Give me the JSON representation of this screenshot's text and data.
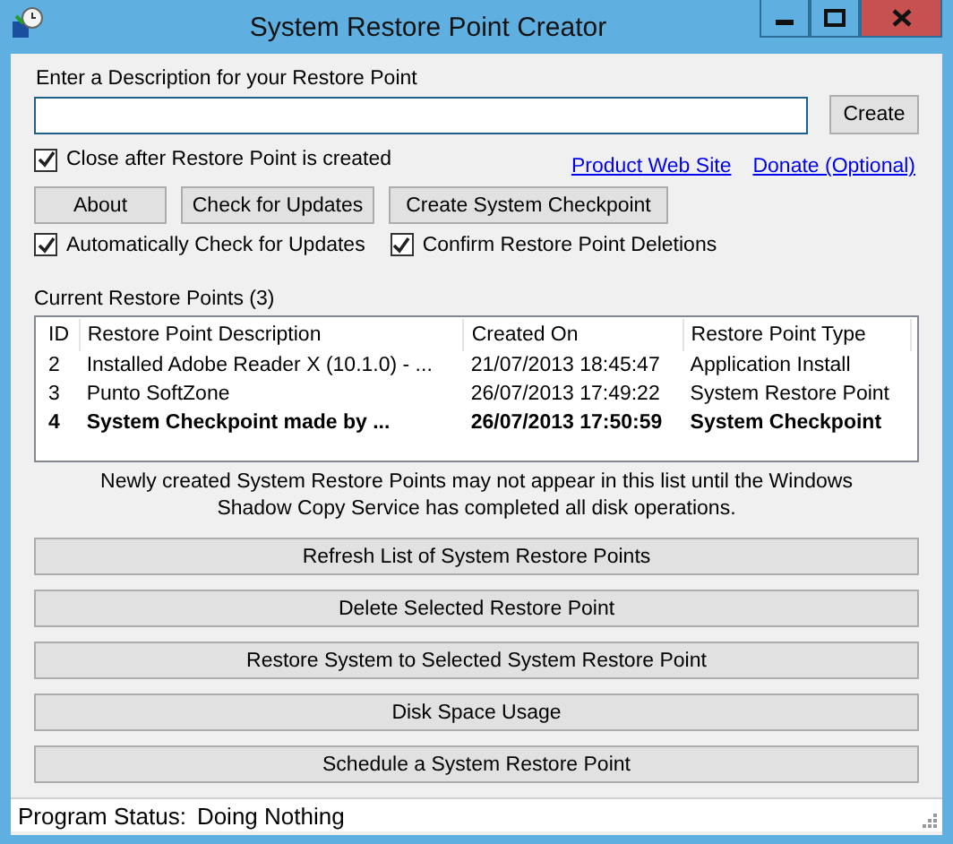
{
  "window": {
    "title": "System Restore Point Creator"
  },
  "description": {
    "label": "Enter a Description for your Restore Point",
    "create_button": "Create"
  },
  "close_after": {
    "label": "Close after Restore Point is created",
    "checked": true
  },
  "links": [
    "Product Web Site",
    "Donate (Optional)"
  ],
  "top_buttons": [
    "About",
    "Check for Updates",
    "Create System Checkpoint"
  ],
  "options": [
    {
      "label": "Automatically Check for Updates",
      "checked": true
    },
    {
      "label": "Confirm Restore Point Deletions",
      "checked": true
    }
  ],
  "list": {
    "title": "Current Restore Points (3)",
    "columns": [
      "ID",
      "Restore Point Description",
      "Created On",
      "Restore Point Type"
    ],
    "rows": [
      {
        "cells": [
          "2",
          "Installed Adobe Reader X (10.1.0) - ...",
          "21/07/2013 18:45:47",
          "Application Install"
        ],
        "bold": false
      },
      {
        "cells": [
          "3",
          "Punto SoftZone",
          "26/07/2013 17:49:22",
          "System Restore Point"
        ],
        "bold": false
      },
      {
        "cells": [
          "4",
          "System Checkpoint made by ...",
          "26/07/2013 17:50:59",
          "System Checkpoint"
        ],
        "bold": true
      }
    ]
  },
  "note": "Newly created System Restore Points may not appear in this list until the Windows Shadow Copy Service has completed all disk operations.",
  "actions": [
    "Refresh List of System Restore Points",
    "Delete Selected Restore Point",
    "Restore System to Selected System Restore Point",
    "Disk Space Usage",
    "Schedule a System Restore Point"
  ],
  "status_bar": {
    "label": "Program Status:",
    "value": "Doing Nothing"
  }
}
